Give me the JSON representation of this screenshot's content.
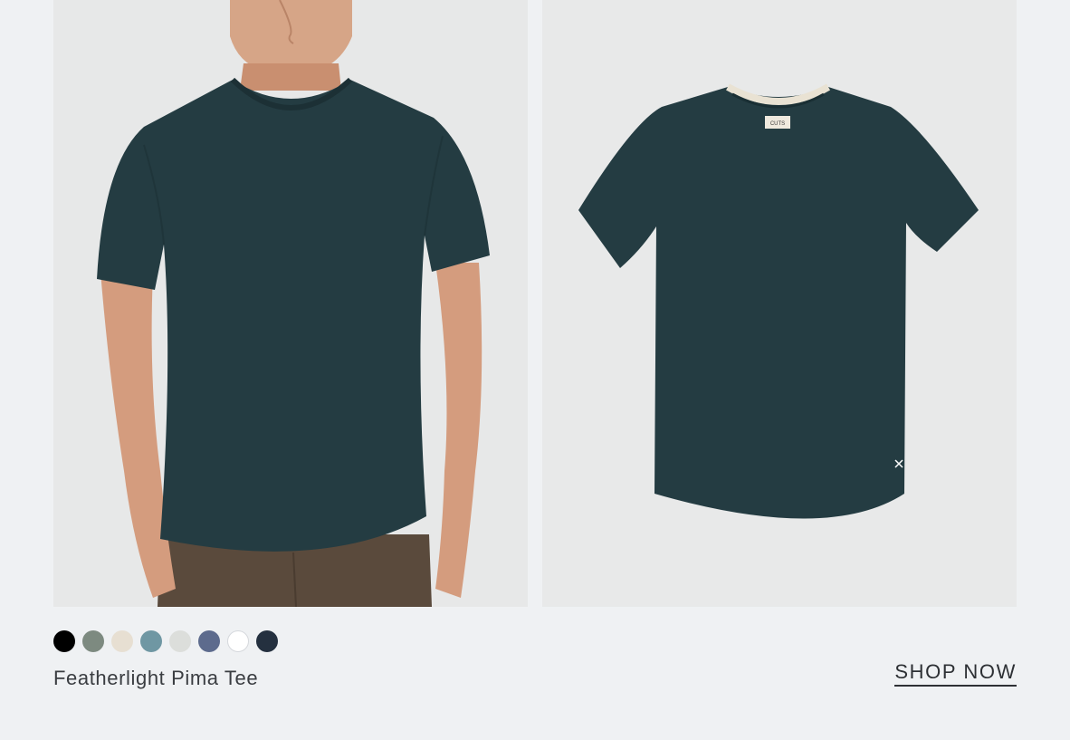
{
  "product": {
    "name": "Featherlight Pima Tee",
    "cta_label": "SHOP NOW",
    "garment_color": "#243c42",
    "swatches": [
      {
        "name": "black",
        "color": "#000000"
      },
      {
        "name": "sage",
        "color": "#7d8a80"
      },
      {
        "name": "sand",
        "color": "#e7dfd2"
      },
      {
        "name": "slate-blue",
        "color": "#6f97a3"
      },
      {
        "name": "light-grey",
        "color": "#dcdedb"
      },
      {
        "name": "denim-blue",
        "color": "#5d6b8d"
      },
      {
        "name": "white",
        "color": "#ffffff"
      },
      {
        "name": "navy",
        "color": "#24303f"
      }
    ]
  },
  "images": {
    "model_photo": "model wearing tee",
    "flat_photo": "flat lay tee",
    "label_text": "CUTS"
  }
}
